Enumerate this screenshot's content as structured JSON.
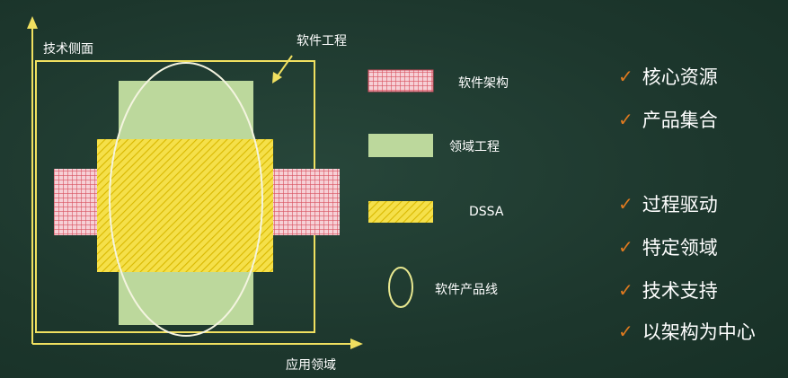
{
  "diagram": {
    "y_axis_label": "技术侧面",
    "x_axis_label": "应用领域",
    "arrow_label": "软件工程"
  },
  "legend": [
    {
      "key": "arch",
      "label": "软件架构",
      "color": "#f3c0c8"
    },
    {
      "key": "domain",
      "label": "领域工程",
      "color": "#b9d69a"
    },
    {
      "key": "dssa",
      "label": "DSSA",
      "color": "#f2dc4a"
    },
    {
      "key": "spl",
      "label": "软件产品线",
      "color": "#f0f0c0"
    }
  ],
  "features": [
    "核心资源",
    "产品集合",
    "过程驱动",
    "特定领域",
    "技术支持",
    "以架构为中心"
  ],
  "colors": {
    "background": "#1f3a30",
    "check": "#e07a1f",
    "frame": "#f0e060"
  }
}
